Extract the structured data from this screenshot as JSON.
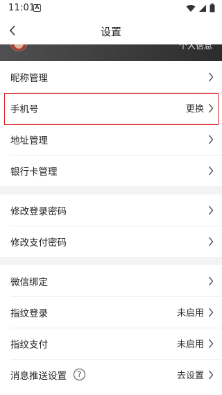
{
  "status_bar": {
    "time": "11:01",
    "notification_glyph": "A"
  },
  "header": {
    "title": "设置"
  },
  "profile": {
    "link_label": "个人信息"
  },
  "rows": [
    {
      "label": "昵称管理",
      "value": ""
    },
    {
      "label": "手机号",
      "value": "更换"
    },
    {
      "label": "地址管理",
      "value": ""
    },
    {
      "label": "银行卡管理",
      "value": ""
    },
    {
      "label": "修改登录密码",
      "value": ""
    },
    {
      "label": "修改支付密码",
      "value": ""
    },
    {
      "label": "微信绑定",
      "value": ""
    },
    {
      "label": "指纹登录",
      "value": "未启用"
    },
    {
      "label": "指纹支付",
      "value": "未启用"
    },
    {
      "label": "消息推送设置",
      "value": "去设置"
    }
  ],
  "highlight_color": "#e0242b"
}
